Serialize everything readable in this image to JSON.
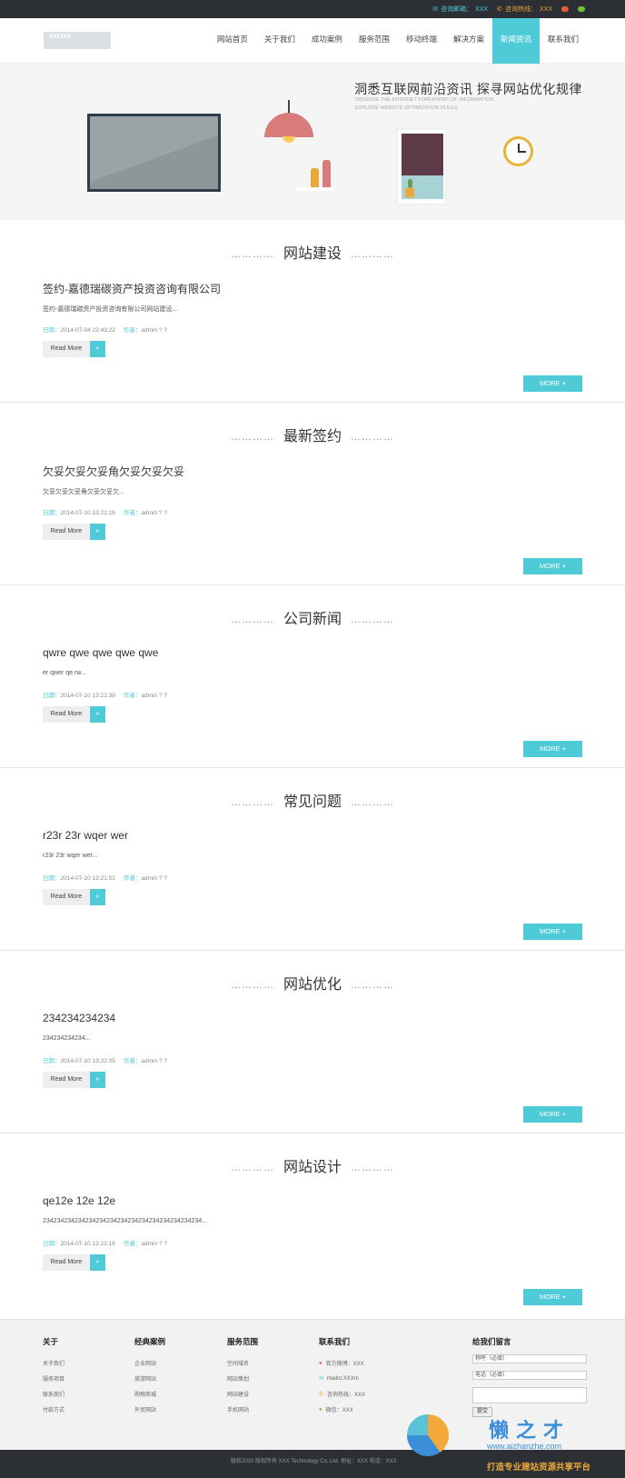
{
  "topbar": {
    "email_label": "咨询邮箱：",
    "email_value": "XXX",
    "phone_label": "咨询热线：",
    "phone_value": "XXX"
  },
  "header": {
    "logo_text": "XXXXXX",
    "nav": [
      {
        "label": "网站首页"
      },
      {
        "label": "关于我们"
      },
      {
        "label": "成功案例"
      },
      {
        "label": "服务范围"
      },
      {
        "label": "移动终端"
      },
      {
        "label": "解决方案"
      },
      {
        "label": "新闻资讯"
      },
      {
        "label": "联系我们"
      }
    ],
    "active_index": 6
  },
  "banner": {
    "title": "洞悉互联网前沿资讯   探寻网站优化规律",
    "subtitle_1": "OBSERVE THE INTERNET FOREFRONT OF INFORMATION,",
    "subtitle_2": "EXPLORE WEBSITE OPTIMIZATION RULES."
  },
  "labels": {
    "date": "日期：",
    "author": "作者：",
    "read_more": "Read More",
    "read_more_arrow": "»",
    "more": "MORE +",
    "dots": "…………"
  },
  "sections": [
    {
      "heading": "网站建设",
      "title": "签约-嘉德瑞碳资产投资咨询有限公司",
      "excerpt": "签约-嘉德瑞碳资产投资咨询有限公司网站建设...",
      "date": "2014-07-04 22:43:22",
      "author": "admin ? ?"
    },
    {
      "heading": "最新签约",
      "title": "欠妥欠妥欠妥角欠妥欠妥欠妥",
      "excerpt": "欠妥欠妥欠妥角欠妥欠妥欠...",
      "date": "2014-07-10 13:21:16",
      "author": "admin ? ?"
    },
    {
      "heading": "公司新闻",
      "title": "qwre qwe qwe qwe qwe",
      "excerpt": "er qwer qe rw...",
      "date": "2014-07-10 13:21:39",
      "author": "admin ? ?"
    },
    {
      "heading": "常见问题",
      "title": "r23r 23r wqer wer",
      "excerpt": "r23r 23r wqer wer...",
      "date": "2014-07-10 13:21:52",
      "author": "admin ? ?"
    },
    {
      "heading": "网站优化",
      "title": "234234234234",
      "excerpt": "234234234234...",
      "date": "2014-07-10 13:22:05",
      "author": "admin ? ?"
    },
    {
      "heading": "网站设计",
      "title": "qe12e 12e 12e",
      "excerpt": "234234234234234234234234234234234234234234234...",
      "date": "2014-07-10 13:22:16",
      "author": "admin ? ?"
    }
  ],
  "footer": {
    "cols": [
      {
        "title": "关于",
        "items": [
          "关于我们",
          "服务项目",
          "联系我们",
          "付款方式"
        ]
      },
      {
        "title": "经典案例",
        "items": [
          "企业网站",
          "旅游网站",
          "购物商城",
          "外贸网站"
        ]
      },
      {
        "title": "服务范围",
        "items": [
          "空间域名",
          "网站策划",
          "网站建设",
          "手机网站"
        ]
      }
    ],
    "contact_title": "联系我们",
    "contact_items": [
      "官方微博：XXX",
      "mailto:XXXm",
      "咨询热线：XXX",
      "微信：XXX"
    ],
    "message_title": "给我们留言",
    "name_placeholder": "称呼（必填）",
    "phone_placeholder": "电话（必填）",
    "submit_label": "提交"
  },
  "copyright": "版权2020 版权所有 XXX Technology Co.,Ltd. 地址：XXX 电话：XXX",
  "watermark": {
    "title": "懒之才",
    "url": "www.aizhanzhe.com",
    "slogan": "打造专业建站资源共享平台"
  },
  "colors": {
    "accent": "#4ecbd6",
    "dark": "#2c2f33",
    "orange": "#e7a23a"
  }
}
